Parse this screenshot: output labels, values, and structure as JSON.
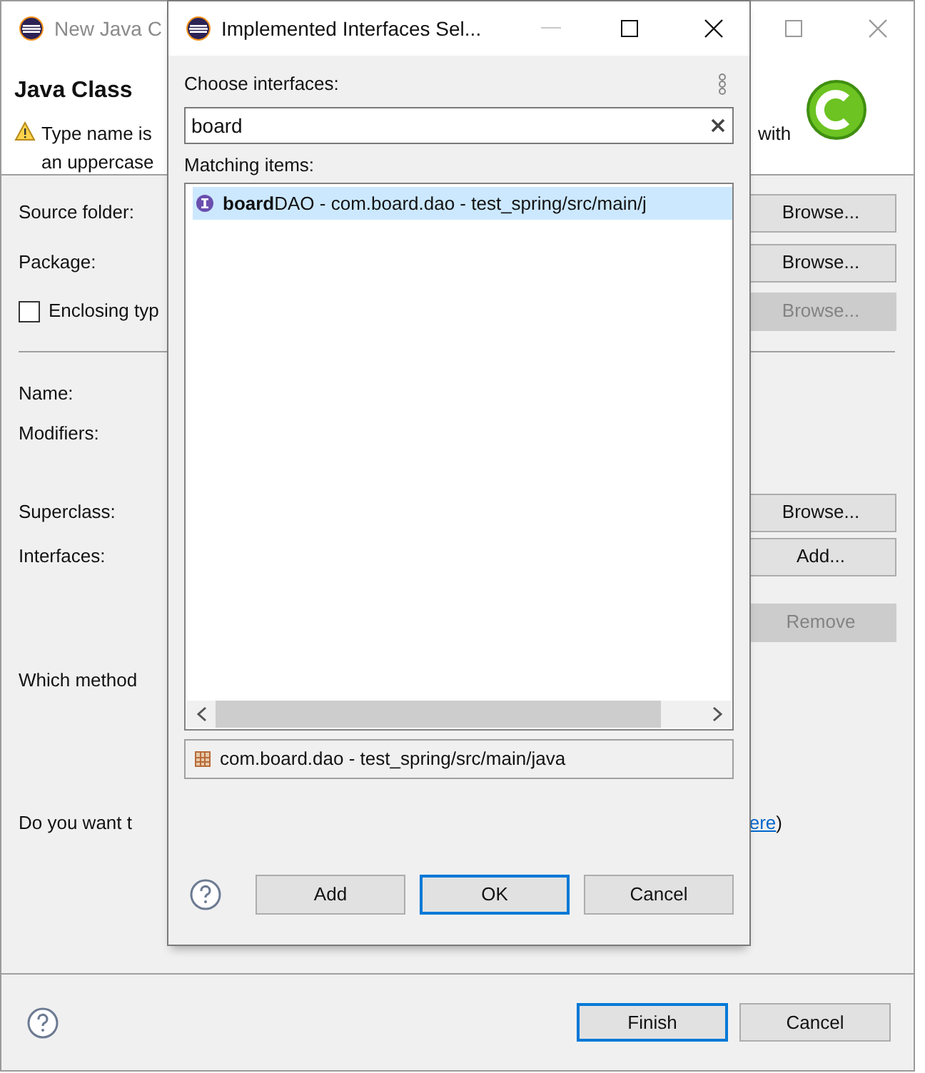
{
  "main_window": {
    "title": "New Java C",
    "active": false,
    "header": {
      "title": "Java Class",
      "message_lines": [
        "Type name is",
        "an uppercase"
      ],
      "message_tail": "with"
    },
    "sections": [
      [
        {
          "kind": "field",
          "label": "Source folder:",
          "button": {
            "label": "Browse...",
            "disabled": false
          }
        },
        {
          "kind": "field",
          "label": "Package:",
          "button": {
            "label": "Browse...",
            "disabled": false
          }
        },
        {
          "kind": "checkbox",
          "label": "Enclosing typ",
          "checked": false,
          "button": {
            "label": "Browse...",
            "disabled": true
          }
        }
      ],
      [
        {
          "kind": "field",
          "label": "Name:"
        },
        {
          "kind": "field",
          "label": "Modifiers:"
        },
        {
          "kind": "field",
          "label": "Superclass:",
          "button": {
            "label": "Browse...",
            "disabled": false
          }
        },
        {
          "kind": "field",
          "label": "Interfaces:",
          "button": {
            "label": "Add...",
            "disabled": false
          }
        },
        {
          "kind": "field",
          "button": {
            "label": "Remove",
            "disabled": true
          }
        },
        {
          "kind": "field",
          "label": "Which method"
        },
        {
          "kind": "link_line",
          "label": "Do you want t",
          "link": "ere",
          "tail": ")"
        }
      ]
    ],
    "buttons": [
      {
        "label": "Finish",
        "default": true
      },
      {
        "label": "Cancel",
        "default": false
      }
    ]
  },
  "dialog": {
    "title": "Implemented Interfaces Sel...",
    "active": true,
    "search": {
      "label": "Choose interfaces:",
      "value": "board"
    },
    "list": {
      "label": "Matching items:",
      "items": [
        {
          "text": "**board**DAO - com.board.dao - test_spring/src/main/j",
          "selected": true
        }
      ]
    },
    "status": "com.board.dao - test_spring/src/main/java",
    "buttons": [
      {
        "label": "Add",
        "default": false
      },
      {
        "label": "OK",
        "default": true
      },
      {
        "label": "Cancel",
        "default": false
      }
    ]
  }
}
